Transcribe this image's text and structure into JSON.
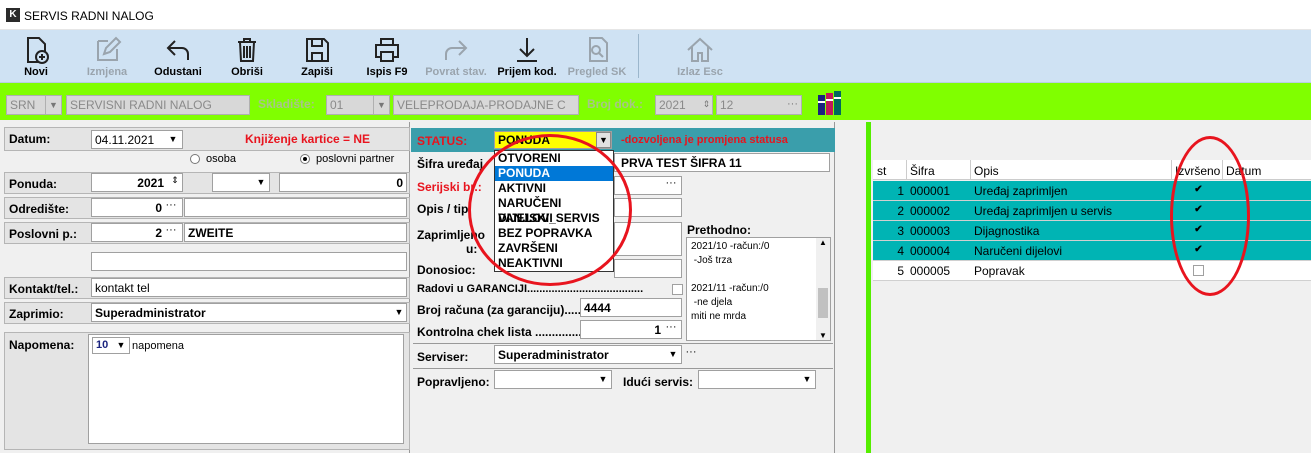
{
  "window": {
    "title": "SERVIS RADNI NALOG"
  },
  "toolbar": {
    "novi": "Novi",
    "izmjena": "Izmjena",
    "odustani": "Odustani",
    "obrisi": "Obriši",
    "zapisi": "Zapiši",
    "ispis": "Ispis F9",
    "povrat": "Povrat stav.",
    "prijem": "Prijem kod.",
    "pregled": "Pregled SK",
    "izlaz": "Izlaz Esc"
  },
  "header": {
    "doc_type": "SRN",
    "doc_name": "SERVISNI RADNI NALOG",
    "skladiste_label": "Skladište:",
    "skladiste_code": "01",
    "skladiste_name": "VELEPRODAJA-PRODAJNE C",
    "broj_label": "Broj dok.:",
    "year": "2021",
    "number": "12"
  },
  "left": {
    "datum_label": "Datum:",
    "datum": "04.11.2021",
    "knjizenje": "Knjiženje kartice = NE",
    "osoba": "osoba",
    "poslovni_partner": "poslovni partner",
    "ponuda_label": "Ponuda:",
    "ponuda_year": "2021",
    "ponuda_num": "0",
    "odrediste_label": "Odredište:",
    "odrediste": "0",
    "poslovni_label": "Poslovni p.:",
    "poslovni_num": "2",
    "poslovni_name": "ZWEITE",
    "kontakt_label": "Kontakt/tel.:",
    "kontakt": "kontakt tel",
    "zaprimio_label": "Zaprimio:",
    "zaprimio": "Superadministrator",
    "napomena_label": "Napomena:",
    "napomena_size": "10",
    "napomena": "napomena"
  },
  "middle": {
    "status_label": "STATUS:",
    "status_value": "PONUDA",
    "status_note": "-dozvoljena je promjena statusa",
    "sifra_label": "Šifra uređaj",
    "sifra_value": "PRVA TEST ŠIFRA 11",
    "serijski_label": "Serijski br.:",
    "opis_label": "Opis / tip",
    "zaprimljeno_label": "Zaprimljeno",
    "zaprimljeno_sub": "u:",
    "donosioc_label": "Donosioc:",
    "garancija_label": "Radovi u GARANCIJI......................................",
    "broj_racuna_label": "Broj računa (za garanciju)......",
    "broj_racuna": "4444",
    "kontrolna_label": "Kontrolna chek lista ...............",
    "kontrolna": "1",
    "prethodno_label": "Prethodno:",
    "prethodno_lines": [
      "2021/10 -račun:/0",
      " -Još trza",
      "",
      "2021/11 -račun:/0",
      " -ne djela",
      "miti ne mrda"
    ],
    "serviser_label": "Serviser:",
    "serviser": "Superadministrator",
    "popravljeno_label": "Popravljeno:",
    "iduci_label": "Idući servis:",
    "status_options": [
      "OTVORENI",
      "PONUDA",
      "AKTIVNI",
      "NARUČENI DIJELOVI",
      "VANJSKI_SERVIS",
      "BEZ POPRAVKA",
      "ZAVRŠENI",
      "NEAKTIVNI"
    ]
  },
  "grid": {
    "columns": [
      "st",
      "Šifra",
      "Opis",
      "Izvršeno",
      "Datum"
    ],
    "rows": [
      {
        "st": "1",
        "sifra": "000001",
        "opis": "Uređaj zaprimljen",
        "done": true
      },
      {
        "st": "2",
        "sifra": "000002",
        "opis": "Uređaj zaprimljen u servis",
        "done": true
      },
      {
        "st": "3",
        "sifra": "000003",
        "opis": "Dijagnostika",
        "done": true
      },
      {
        "st": "4",
        "sifra": "000004",
        "opis": "Naručeni dijelovi",
        "done": true
      },
      {
        "st": "5",
        "sifra": "000005",
        "opis": "Popravak",
        "done": false
      }
    ],
    "row_color": "#00b4b4"
  }
}
